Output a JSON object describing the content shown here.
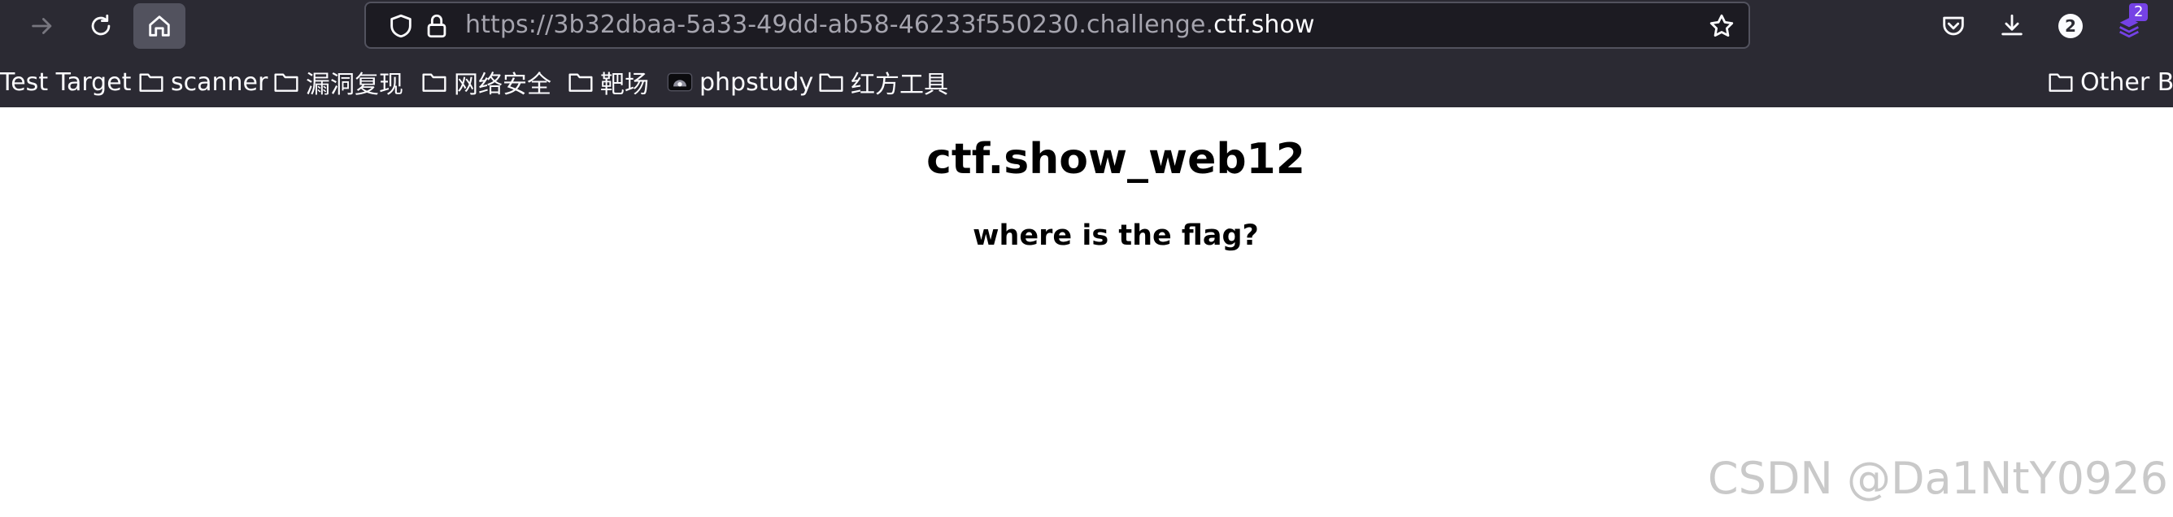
{
  "browser": {
    "url_prefix": "https://3b32dbaa-5a33-49dd-ab58-46233f550230.challenge.",
    "url_domain": "ctf.show",
    "toolbar_badge_count": "2",
    "extension_badge_count": "2"
  },
  "bookmarks": [
    {
      "label": "Test Target",
      "icon": "none"
    },
    {
      "label": "scanner",
      "icon": "folder-icon"
    },
    {
      "label": "漏洞复现",
      "icon": "folder-icon"
    },
    {
      "label": "网络安全",
      "icon": "folder-icon"
    },
    {
      "label": "靶场",
      "icon": "folder-icon"
    },
    {
      "label": "phpstudy",
      "icon": "phpstudy-icon"
    },
    {
      "label": "红方工具",
      "icon": "folder-icon"
    },
    {
      "label": "Other Bo",
      "icon": "folder-icon"
    }
  ],
  "page": {
    "title": "ctf.show_web12",
    "subtitle": "where is the flag?"
  },
  "watermark": "CSDN @Da1NtY0926"
}
